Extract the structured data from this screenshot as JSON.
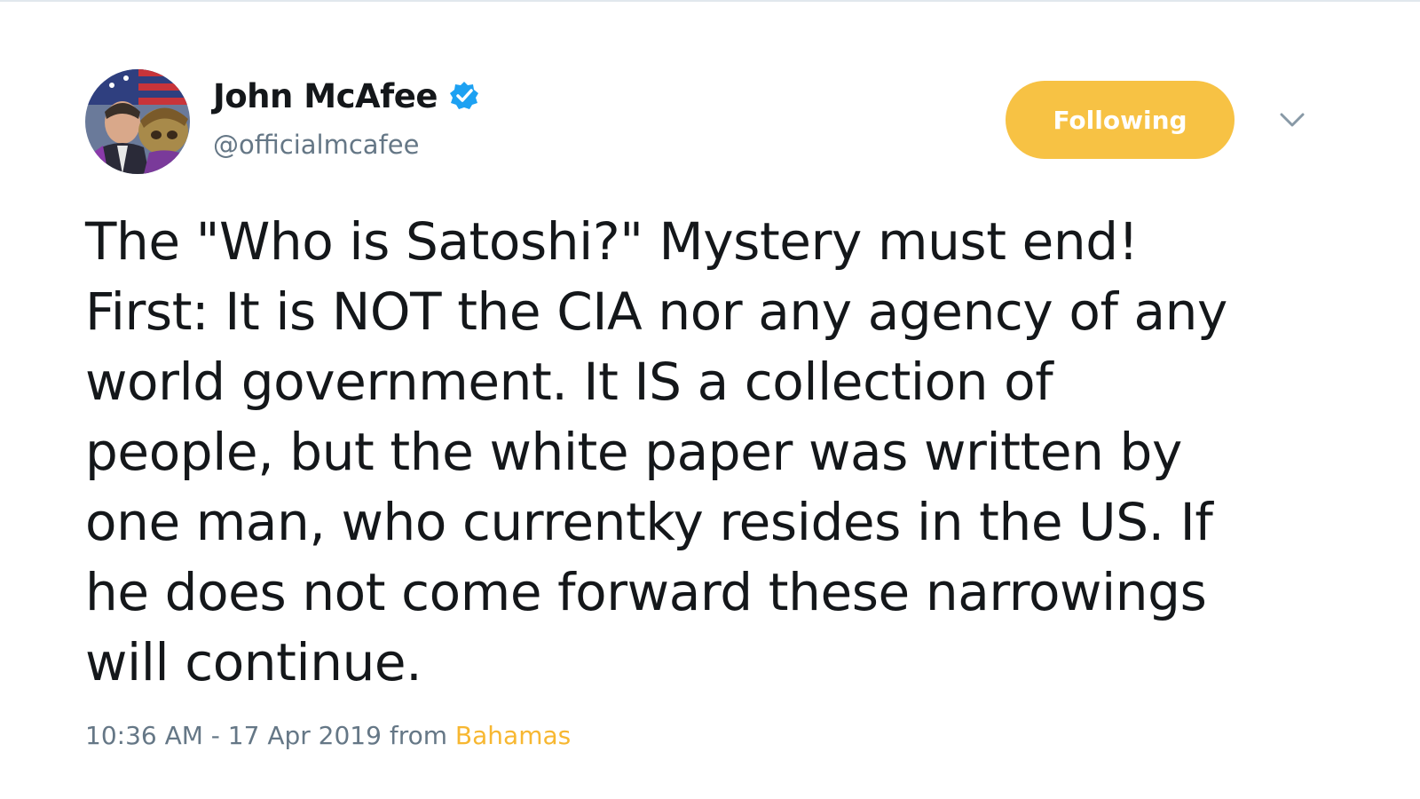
{
  "tweet": {
    "author": {
      "display_name": "John McAfee",
      "handle": "@officialmcafee",
      "verified": true
    },
    "follow_button_label": "Following",
    "menu_icon": "chevron-down-icon",
    "text_lines": [
      "The \"Who is Satoshi?\" Mystery must end!",
      "First: It is NOT the CIA nor any agency of any",
      "world government. It IS a collection of",
      "people, but the white paper was written by",
      "one man, who currentky resides in the US. If",
      "he does not come forward these narrowings",
      "will continue."
    ],
    "timestamp": "10:36 AM - 17 Apr 2019",
    "source_prefix": "from",
    "location": "Bahamas"
  },
  "colors": {
    "follow_button": "#f7c244",
    "location_link": "#f7b731",
    "verified_badge": "#1da1f2",
    "secondary_text": "#657786",
    "primary_text": "#14171a"
  }
}
